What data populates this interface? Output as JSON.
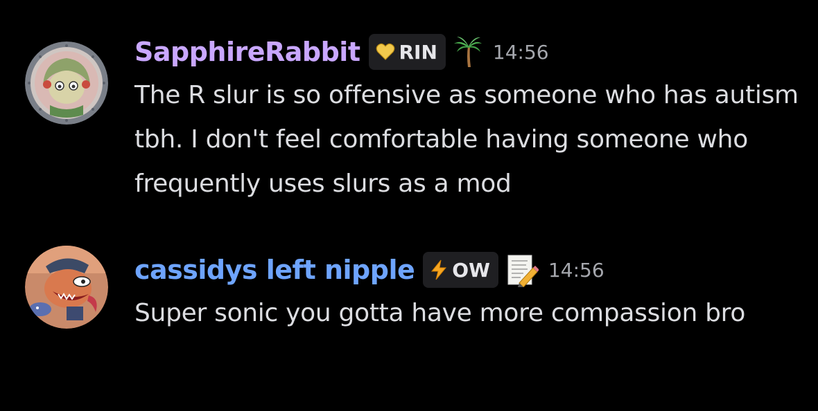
{
  "colors": {
    "background": "#000000",
    "user1_name": "#c9a7ff",
    "user2_name": "#6ea4ff",
    "text": "#dcdde1",
    "timestamp": "#a5a7ad",
    "tag_bg": "#1f1f22"
  },
  "messages": [
    {
      "username": "SapphireRabbit",
      "tag": {
        "icon": "yellow-heart-icon",
        "text": "RIN"
      },
      "role_icon": "palm-tree-icon",
      "timestamp": "14:56",
      "content": "The R slur is so offensive as someone who has autism tbh.  I don't feel comfortable having someone who frequently uses slurs as a mod"
    },
    {
      "username": "cassidys left nipple",
      "tag": {
        "icon": "lightning-icon",
        "text": "OW"
      },
      "role_icon": "memo-icon",
      "timestamp": "14:56",
      "content": "Super sonic you gotta have more compassion bro"
    }
  ]
}
